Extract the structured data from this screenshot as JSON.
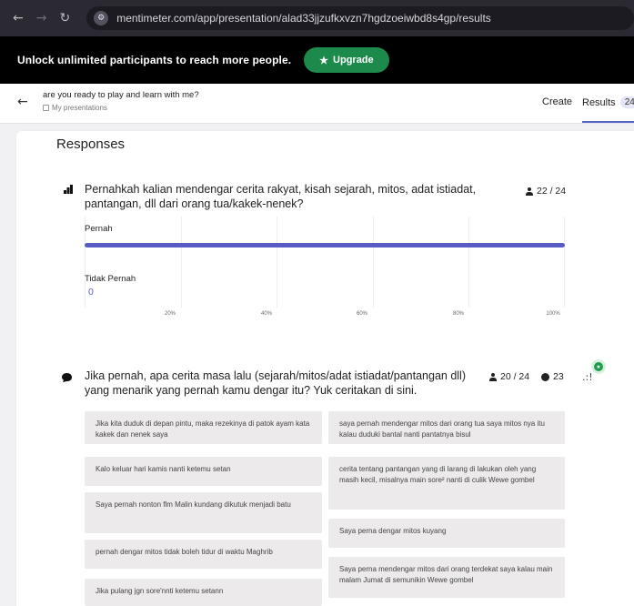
{
  "browser": {
    "url": "mentimeter.com/app/presentation/alad33jjzufkxvzn7hgdzoeiwbd8s4gp/results",
    "site_icon": "tune-icon"
  },
  "promo": {
    "text": "Unlock unlimited participants to reach more people.",
    "upgrade_label": "Upgrade"
  },
  "header": {
    "title": "are you ready to play and learn with me?",
    "breadcrumb": "My presentations",
    "tabs": [
      {
        "label": "Create"
      },
      {
        "label": "Results",
        "count": "24"
      }
    ]
  },
  "main": {
    "section_title": "Responses",
    "questions": [
      {
        "type": "multiple-choice",
        "text": "Pernahkah kalian mendengar cerita rakyat, kisah sejarah, mitos, adat istiadat, pantangan, dll dari orang tua/kakek-nenek?",
        "participants": "22 / 24",
        "chart_data": {
          "type": "bar",
          "orientation": "horizontal",
          "categories": [
            "Pernah",
            "Tidak Pernah"
          ],
          "values": [
            22,
            0
          ],
          "value_labels": [
            "",
            "0"
          ],
          "tick_labels": [
            "20%",
            "40%",
            "60%",
            "80%",
            "100%"
          ],
          "xlim": [
            0,
            100
          ],
          "color": "#5a5cc6",
          "grid": true
        }
      },
      {
        "type": "open-ended",
        "text": "Jika pernah, apa cerita masa lalu (sejarah/mitos/adat istiadat/pantangan dll) yang menarik yang pernah kamu dengar itu? Yuk ceritakan di sini.",
        "participants": "20 / 24",
        "responses_count": "23",
        "responses_left": [
          "Jika kita duduk di depan pintu, maka rezekinya di patok ayam kata kakek dan nenek saya",
          "Kalo keluar hari kamis nanti ketemu setan",
          "Saya pernah nonton flm Malin kundang dikutuk menjadi batu",
          "pernah dengar mitos tidak boleh tidur di waktu Maghrib",
          "Jika pulang jgn sore'nnti ketemu setann"
        ],
        "responses_right": [
          "saya pernah mendengar mitos dari orang tua saya mitos nya itu kalau duduki bantal nanti pantatnya bisul",
          "cerita tentang pantangan yang di larang di lakukan oleh yang masih kecil, misalnya main sore² nanti di culik Wewe gombel",
          "Saya perna dengar mitos kuyang",
          "Saya perna mendengar mitos dari orang terdekat saya kalau main malam Jumat di semunikin Wewe gombel"
        ]
      }
    ]
  },
  "colors": {
    "accent": "#5a5cc6",
    "upgrade": "#1c8a4a",
    "tab_underline": "#5a63c8"
  }
}
